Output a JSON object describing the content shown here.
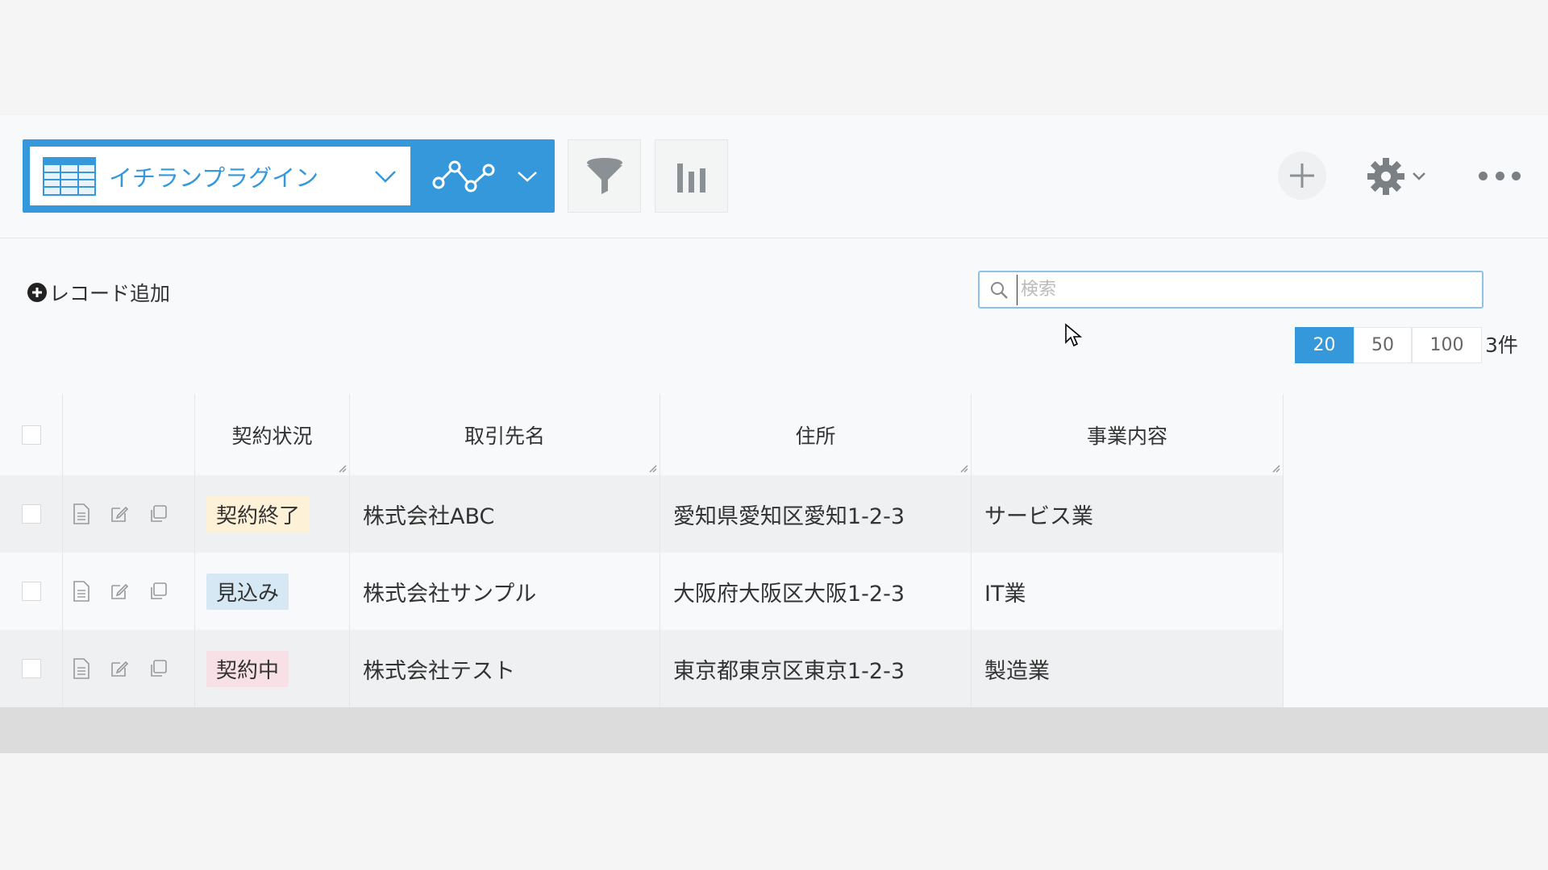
{
  "header": {
    "view_name": "イチランプラグイン",
    "icons": [
      "grid-icon",
      "chevron-down-icon",
      "graph-icon",
      "filter-icon",
      "bar-chart-icon",
      "plus-icon",
      "gear-icon",
      "more-icon"
    ]
  },
  "toolbar": {
    "add_record_label": "レコード追加",
    "search_placeholder": "検索"
  },
  "pager": {
    "options": [
      "20",
      "50",
      "100"
    ],
    "selected": "20",
    "count_label": "3件"
  },
  "table": {
    "columns": [
      "契約状況",
      "取引先名",
      "住所",
      "事業内容"
    ],
    "rows": [
      {
        "status": "契約終了",
        "status_color": "#fdf1d8",
        "name": "株式会社ABC",
        "address": "愛知県愛知区愛知1-2-3",
        "business": "サービス業"
      },
      {
        "status": "見込み",
        "status_color": "#d5e8f3",
        "name": "株式会社サンプル",
        "address": "大阪府大阪区大阪1-2-3",
        "business": "IT業"
      },
      {
        "status": "契約中",
        "status_color": "#f8e1e6",
        "name": "株式会社テスト",
        "address": "東京都東京区東京1-2-3",
        "business": "製造業"
      }
    ]
  },
  "colors": {
    "accent": "#3498db"
  }
}
